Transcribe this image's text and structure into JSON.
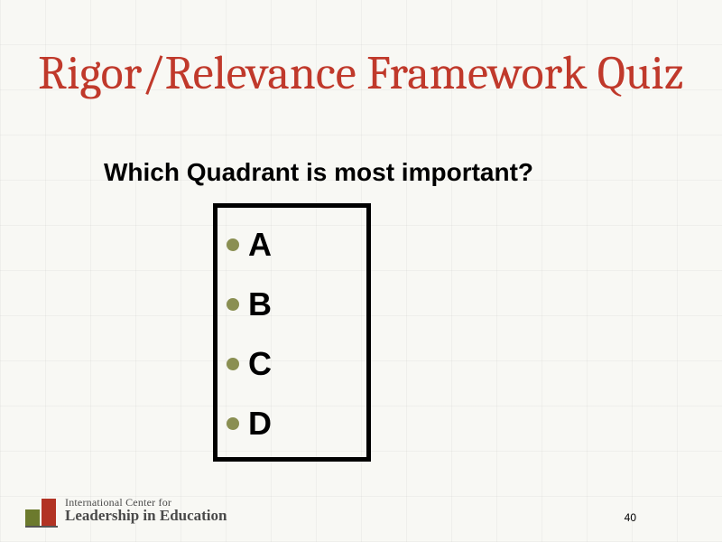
{
  "title": "Rigor/Relevance Framework Quiz",
  "question": "Which Quadrant is most important?",
  "options": [
    "A",
    "B",
    "C",
    "D"
  ],
  "page_number": "40",
  "footer": {
    "line1": "International Center for",
    "line2": "Leadership in Education"
  },
  "colors": {
    "title_color": "#c0392b",
    "bullet_color": "#8a8f52",
    "box_border": "#000000"
  }
}
